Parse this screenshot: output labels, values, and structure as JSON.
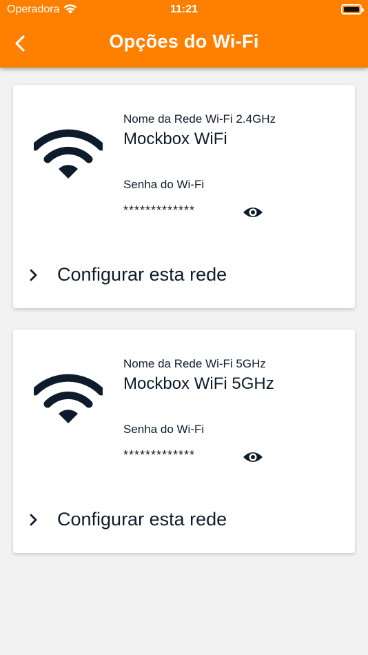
{
  "status_bar": {
    "carrier": "Operadora",
    "time": "11:21"
  },
  "header": {
    "title": "Opções do Wi-Fi",
    "background_color": "#ff7f00"
  },
  "networks": [
    {
      "label": "Nome da Rede Wi-Fi 2.4GHz",
      "name": "Mockbox WiFi",
      "password_label": "Senha do Wi-Fi",
      "password_masked": "*************",
      "action_label": "Configurar esta rede",
      "icon": "wifi-icon"
    },
    {
      "label": "Nome da Rede Wi-Fi 5GHz",
      "name": "Mockbox WiFi 5GHz",
      "password_label": "Senha do Wi-Fi",
      "password_masked": "*************",
      "action_label": "Configurar esta rede",
      "icon": "wifi-icon"
    }
  ]
}
